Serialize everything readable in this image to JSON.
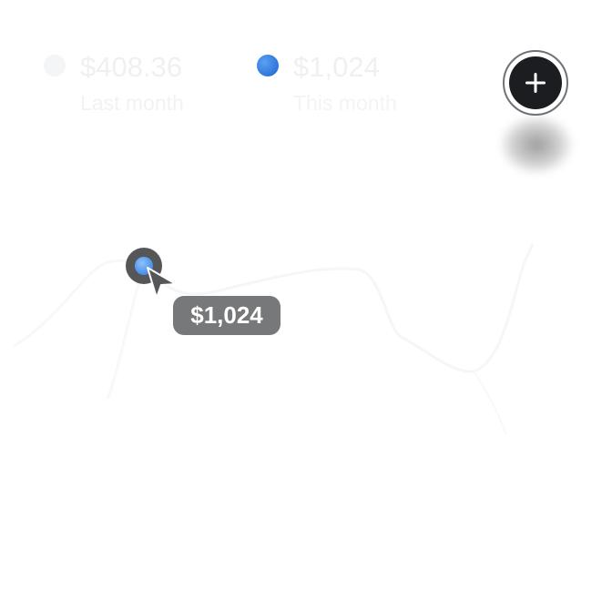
{
  "legend": {
    "last_month": {
      "amount": "$408.36",
      "caption": "Last month",
      "color": "#f4f5f6"
    },
    "this_month": {
      "amount": "$1,024",
      "caption": "This month",
      "color": "#3a82e4"
    }
  },
  "add_button": {
    "icon": "plus-icon",
    "color": "#1b1d20"
  },
  "tooltip": {
    "value": "$1,024"
  },
  "hover_point": {
    "color": "#3d86e8"
  },
  "cursor": {
    "icon": "arrow-cursor-icon",
    "color": "#565758"
  }
}
